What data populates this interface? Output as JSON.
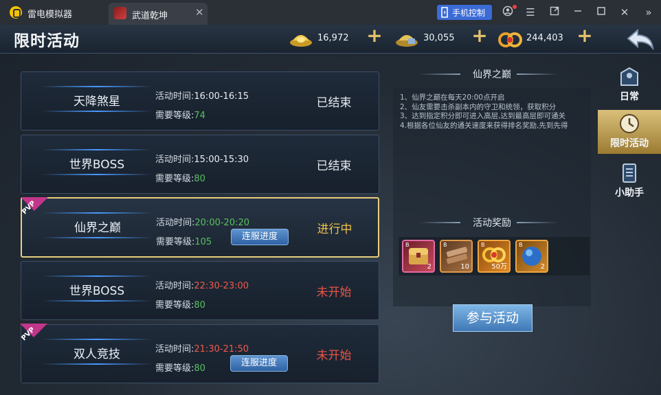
{
  "emulator": {
    "app_name": "雷电模拟器",
    "tab_title": "武道乾坤",
    "control_label": "手机控制"
  },
  "header": {
    "title": "限时活动",
    "resources": [
      {
        "name": "gold-ingot",
        "value": "16,972"
      },
      {
        "name": "silver-ingot",
        "value": "30,055"
      },
      {
        "name": "coins",
        "value": "244,403"
      }
    ]
  },
  "activities": [
    {
      "name": "天降煞星",
      "time_label": "活动时间:",
      "time": "16:00-16:15",
      "level_label": "需要等级:",
      "level": "74",
      "status": "已结束",
      "pvp": false,
      "server_btn": ""
    },
    {
      "name": "世界BOSS",
      "time_label": "活动时间:",
      "time": "15:00-15:30",
      "level_label": "需要等级:",
      "level": "80",
      "status": "已结束",
      "pvp": false,
      "server_btn": ""
    },
    {
      "name": "仙界之巅",
      "time_label": "活动时间:",
      "time": "20:00-20:20",
      "level_label": "需要等级:",
      "level": "105",
      "status": "进行中",
      "pvp": true,
      "pvp_label": "PVP",
      "server_btn": "连服进度"
    },
    {
      "name": "世界BOSS",
      "time_label": "活动时间:",
      "time": "22:30-23:00",
      "level_label": "需要等级:",
      "level": "80",
      "status": "未开始",
      "pvp": false,
      "server_btn": ""
    },
    {
      "name": "双人竞技",
      "time_label": "活动时间:",
      "time": "21:30-21:50",
      "level_label": "需要等级:",
      "level": "80",
      "status": "未开始",
      "pvp": true,
      "pvp_label": "PVP",
      "server_btn": "连服进度"
    }
  ],
  "detail": {
    "title": "仙界之巅",
    "lines": [
      "1、仙界之巅在每天20:00点开启",
      "2、仙友需要击杀副本内的守卫和统领，获取积分",
      "3、达到指定积分即可进入高层,达到最高层即可通关",
      "4.根据各位仙友的通关速度来获得排名奖励,先到先得"
    ],
    "reward_title": "活动奖励",
    "rewards": [
      {
        "name": "treasure-chest",
        "count": "2",
        "tag": "B"
      },
      {
        "name": "wooden-tablet",
        "count": "10",
        "tag": "B"
      },
      {
        "name": "coin-bundle",
        "count": "50万",
        "tag": "B"
      },
      {
        "name": "blue-orb",
        "count": "2",
        "tag": "B"
      }
    ],
    "join_label": "参与活动"
  },
  "side_nav": [
    {
      "label": "日常",
      "icon": "daily-icon"
    },
    {
      "label": "限时活动",
      "icon": "timed-event-icon"
    },
    {
      "label": "小助手",
      "icon": "assistant-icon"
    }
  ]
}
